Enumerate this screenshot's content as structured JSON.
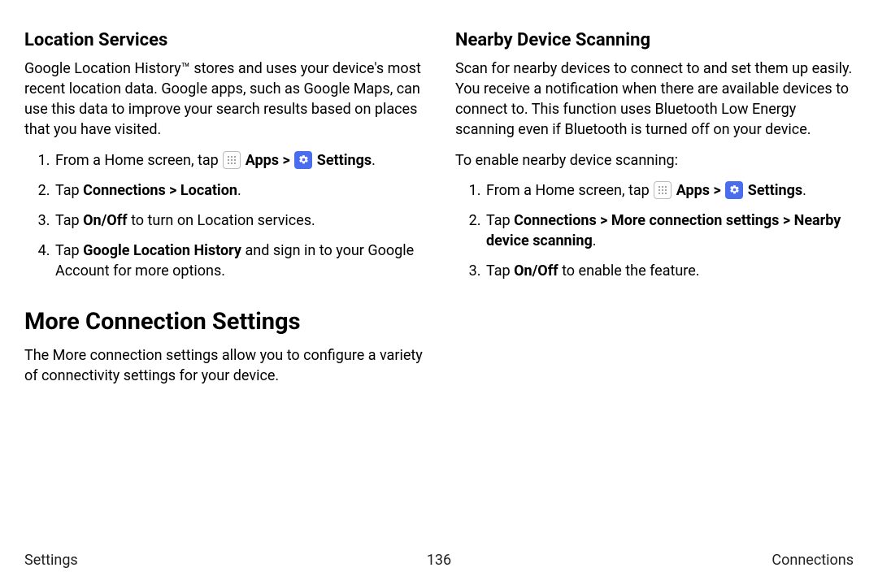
{
  "left": {
    "h_location": "Location Services",
    "p_location": "Google Location History™ stores and uses your device's most recent location data. Google apps, such as Google Maps, can use this data to improve your search results based on places that you have visited.",
    "li1_pre": "From a Home screen, tap ",
    "li1_apps": "Apps",
    "li1_settings": "Settings",
    "li1_post": ".",
    "li2_pre": "Tap ",
    "li2_bold": "Connections > Location",
    "li2_post": ".",
    "li3_pre": "Tap ",
    "li3_bold": "On/Off",
    "li3_post": " to turn on Location services.",
    "li4_pre": "Tap ",
    "li4_bold": "Google Location History",
    "li4_post": " and sign in to your Google Account for more options.",
    "h_more": "More Connection Settings",
    "p_more": "The More connection settings allow you to configure a variety of connectivity settings for your device."
  },
  "right": {
    "h_nearby": "Nearby Device Scanning",
    "p_nearby": "Scan for nearby devices to connect to and set them up easily. You receive a notification when there are available devices to connect to. This function uses Bluetooth Low Energy scanning even if Bluetooth is turned off on your device.",
    "p_enable": "To enable nearby device scanning:",
    "li1_pre": "From a Home screen, tap ",
    "li1_apps": "Apps",
    "li1_settings": "Settings",
    "li1_post": ".",
    "li2_pre": "Tap ",
    "li2_bold": "Connections > More connection settings > Nearby device scanning",
    "li2_post": ".",
    "li3_pre": "Tap ",
    "li3_bold": "On/Off",
    "li3_post": " to enable the feature."
  },
  "footer": {
    "left": "Settings",
    "center": "136",
    "right": "Connections"
  },
  "glyphs": {
    "chev": ">"
  }
}
